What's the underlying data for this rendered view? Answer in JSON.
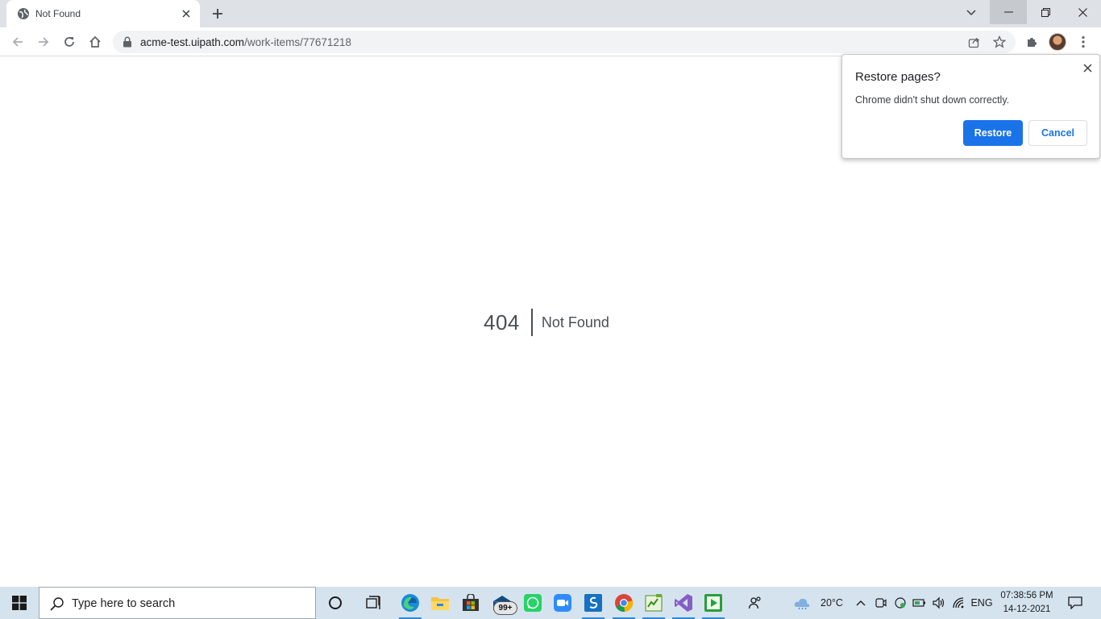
{
  "browser": {
    "tab": {
      "title": "Not Found"
    },
    "address": {
      "host": "acme-test.uipath.com",
      "path": "/work-items/77671218"
    }
  },
  "page": {
    "code": "404",
    "message": "Not Found"
  },
  "restore_popup": {
    "title": "Restore pages?",
    "body": "Chrome didn't shut down correctly.",
    "restore_label": "Restore",
    "cancel_label": "Cancel"
  },
  "taskbar": {
    "search_placeholder": "Type here to search",
    "mail_badge": "99+",
    "weather": "20°C",
    "language": "ENG",
    "time": "07:38:56 PM",
    "date": "14-12-2021",
    "pinned_icons": [
      "cortana-icon",
      "task-view-icon",
      "edge-icon",
      "file-explorer-icon",
      "store-icon",
      "mail-icon",
      "whatsapp-icon",
      "zoom-icon",
      "uipath-studio-icon",
      "chrome-icon",
      "notepad-plus-icon",
      "visual-studio-icon",
      "uipath-player-icon"
    ]
  },
  "colors": {
    "accent": "#1a73e8",
    "taskbar": "#d5e3ef",
    "titlebar": "#dee1e6"
  }
}
